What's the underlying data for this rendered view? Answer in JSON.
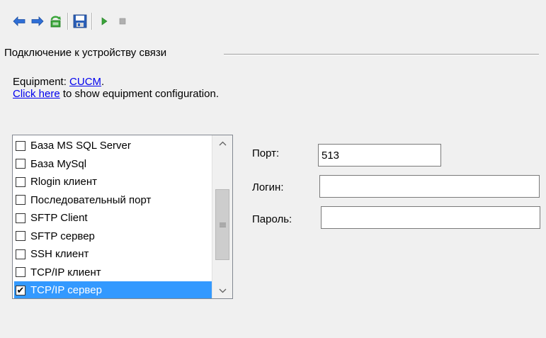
{
  "toolbar": {
    "buttons": [
      {
        "icon": "arrow-left-icon",
        "color": "#2f6fd6"
      },
      {
        "icon": "arrow-right-icon",
        "color": "#2f6fd6"
      },
      {
        "icon": "refresh-icon",
        "color": "#3aa53a"
      },
      {
        "icon": "save-icon",
        "color": "#2b5fb8"
      },
      {
        "icon": "play-icon",
        "color": "#3aa53a"
      },
      {
        "icon": "stop-icon",
        "color": "#a0a0a0"
      }
    ]
  },
  "group": {
    "title": "Подключение к устройству связи"
  },
  "equipment": {
    "prefix": "Equipment: ",
    "link": "CUCM",
    "suffix": "."
  },
  "config": {
    "link": "Click here",
    "text": " to show equipment configuration."
  },
  "list": {
    "items": [
      {
        "label": "База MS SQL Server",
        "checked": false,
        "selected": false
      },
      {
        "label": "База MySql",
        "checked": false,
        "selected": false
      },
      {
        "label": "Rlogin клиент",
        "checked": false,
        "selected": false
      },
      {
        "label": "Последовательный порт",
        "checked": false,
        "selected": false
      },
      {
        "label": "SFTP Client",
        "checked": false,
        "selected": false
      },
      {
        "label": "SFTP сервер",
        "checked": false,
        "selected": false
      },
      {
        "label": "SSH клиент",
        "checked": false,
        "selected": false
      },
      {
        "label": "TCP/IP клиент",
        "checked": false,
        "selected": false
      },
      {
        "label": "TCP/IP сервер",
        "checked": true,
        "selected": true
      }
    ],
    "selection_color": "#3399ff"
  },
  "fields": {
    "port": {
      "label": "Порт:",
      "value": "513"
    },
    "login": {
      "label": "Логин:",
      "value": ""
    },
    "password": {
      "label": "Пароль:",
      "value": ""
    }
  }
}
